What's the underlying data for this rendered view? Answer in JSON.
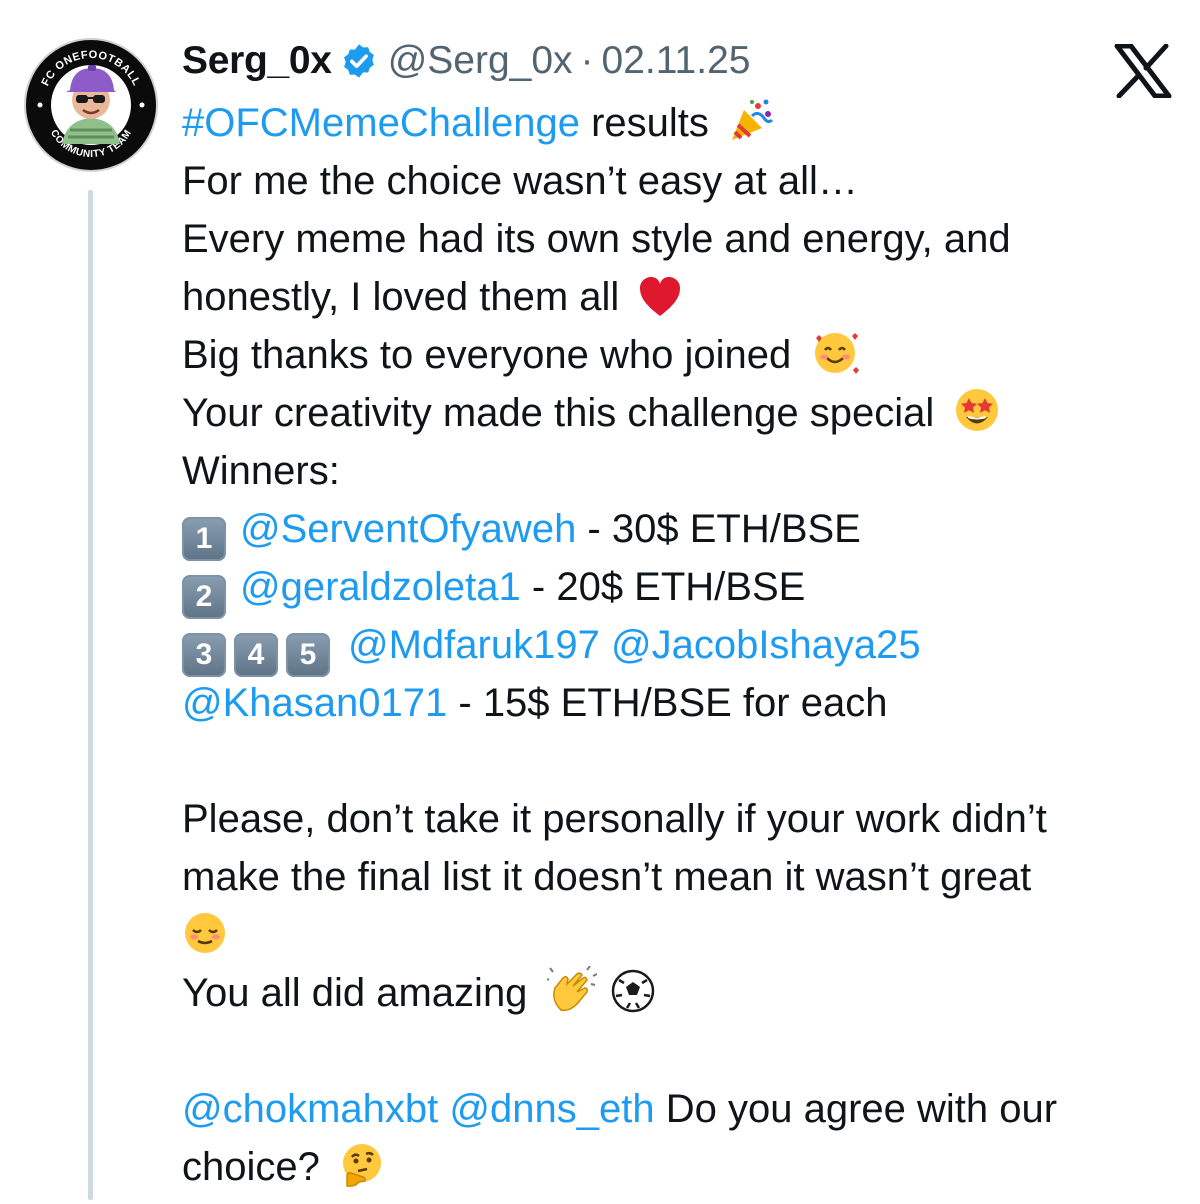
{
  "author": {
    "display_name": "Serg_0x",
    "handle": "@Serg_0x",
    "separator": "·",
    "date": "02.11.25",
    "verified_icon": "verified-badge-icon",
    "avatar_ring_top": "FC ONEFOOTBALL",
    "avatar_ring_bottom": "COMMUNITY TEAM"
  },
  "platform_icon": "x-logo-icon",
  "colors": {
    "link": "#1d9bf0",
    "text": "#0f1419",
    "muted": "#536471",
    "thread_line": "#cfd9de"
  },
  "tweet": {
    "hashtag": "#OFCMemeChallenge",
    "line1_rest": " results",
    "line1_emoji": "party-popper-emoji",
    "line2": "For me the choice wasn’t easy at all…",
    "line3": "Every meme had its own style and energy, and",
    "line4": "honestly, I loved them all",
    "line4_emoji": "red-heart-emoji",
    "line5": "Big thanks to everyone who joined",
    "line5_emoji": "smiling-face-with-hearts-emoji",
    "line6": "Your creativity made this challenge special",
    "line6_emoji": "star-struck-emoji",
    "winners_label": "Winners:",
    "winner1": {
      "rank": "1",
      "handle": "@ServentOfyaweh",
      "prize": " - 30$ ETH/BSE"
    },
    "winner2": {
      "rank": "2",
      "handle": "@geraldzoleta1",
      "prize": " - 20$ ETH/BSE"
    },
    "winner345": {
      "ranks": [
        "3",
        "4",
        "5"
      ],
      "handle_a": "@Mdfaruk197",
      "handle_b": "@JacobIshaya25",
      "handle_c": "@Khasan0171",
      "prize": " - 15$ ETH/BSE for each"
    },
    "line_please1": "Please, don’t take it personally if your work didn’t",
    "line_please2": "make the final list it doesn’t mean it wasn’t great",
    "line_relieved_emoji": "relieved-face-emoji",
    "line_amazing": "You all did amazing",
    "line_amazing_emojis": [
      "clapping-hands-emoji",
      "soccer-ball-emoji"
    ],
    "mention1": "@chokmahxbt",
    "mention2": "@dnns_eth",
    "question_rest": " Do you agree with our",
    "question_end": "choice?",
    "question_emoji": "thinking-face-emoji"
  }
}
